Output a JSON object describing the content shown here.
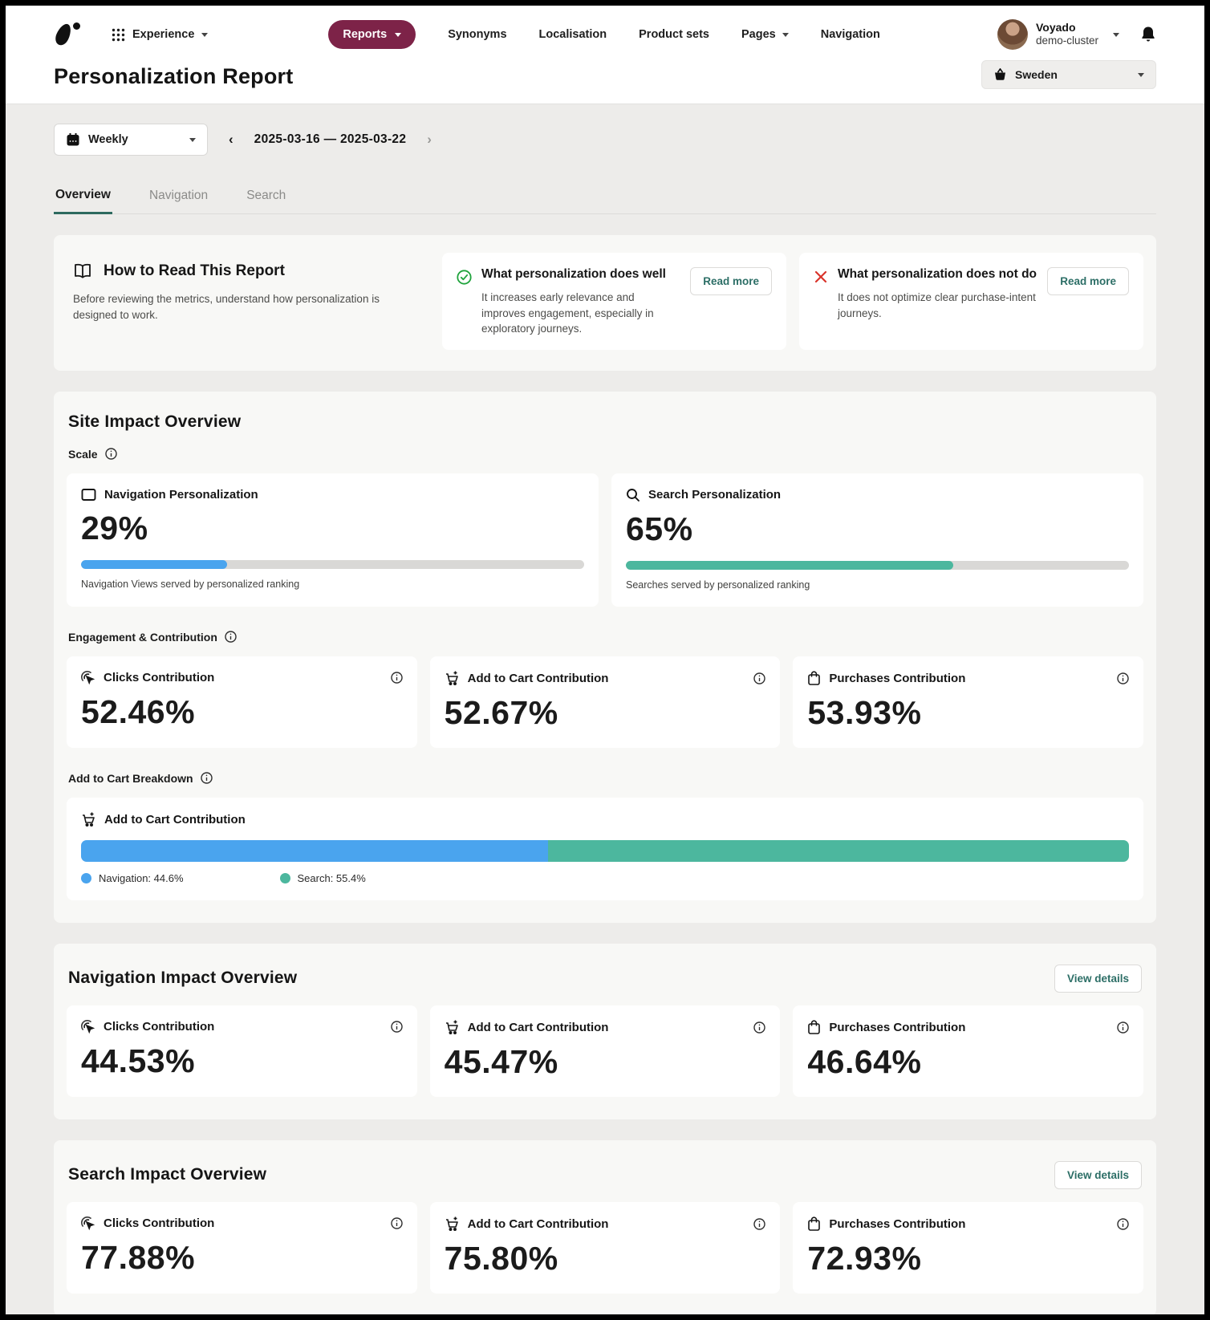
{
  "header": {
    "app_switcher_label": "Experience",
    "nav": {
      "reports": "Reports",
      "synonyms": "Synonyms",
      "localisation": "Localisation",
      "product_sets": "Product sets",
      "pages": "Pages",
      "navigation": "Navigation"
    },
    "user": {
      "name": "Voyado",
      "cluster": "demo-cluster"
    },
    "page_title": "Personalization Report",
    "market": "Sweden"
  },
  "controls": {
    "period": "Weekly",
    "date_range": "2025-03-16 — 2025-03-22",
    "prev": "‹",
    "next": "›"
  },
  "tabs": {
    "overview": "Overview",
    "navigation": "Navigation",
    "search": "Search"
  },
  "how_to": {
    "title": "How to Read This Report",
    "desc": "Before reviewing the metrics, understand how personalization is designed to work.",
    "good": {
      "title": "What personalization does well",
      "desc": "It increases early relevance and improves engagement, especially in exploratory journeys.",
      "button": "Read more"
    },
    "bad": {
      "title": "What personalization does not do",
      "desc": "It does not optimize clear purchase-intent journeys.",
      "button": "Read more"
    }
  },
  "site_impact": {
    "title": "Site Impact Overview",
    "scale_label": "Scale",
    "nav_card": {
      "title": "Navigation Personalization",
      "value": "29%",
      "pct": 29,
      "caption": "Navigation Views served by personalized ranking"
    },
    "search_card": {
      "title": "Search Personalization",
      "value": "65%",
      "pct": 65,
      "caption": "Searches served by personalized ranking"
    },
    "engagement_label": "Engagement & Contribution",
    "engagement": {
      "clicks": {
        "title": "Clicks Contribution",
        "value": "52.46%"
      },
      "add_to_cart": {
        "title": "Add to Cart  Contribution",
        "value": "52.67%"
      },
      "purchases": {
        "title": "Purchases  Contribution",
        "value": "53.93%"
      }
    },
    "breakdown_label": "Add to Cart Breakdown",
    "breakdown": {
      "title": "Add to Cart Contribution",
      "navigation_pct": 44.6,
      "search_pct": 55.4,
      "legend_navigation": "Navigation: 44.6%",
      "legend_search": "Search: 55.4%"
    }
  },
  "navigation_impact": {
    "title": "Navigation Impact Overview",
    "view_details": "View details",
    "clicks": {
      "title": "Clicks Contribution",
      "value": "44.53%"
    },
    "add_to_cart": {
      "title": "Add to Cart  Contribution",
      "value": "45.47%"
    },
    "purchases": {
      "title": "Purchases  Contribution",
      "value": "46.64%"
    }
  },
  "search_impact": {
    "title": "Search Impact Overview",
    "view_details": "View details",
    "clicks": {
      "title": "Clicks Contribution",
      "value": "77.88%"
    },
    "add_to_cart": {
      "title": "Add to Cart  Contribution",
      "value": "75.80%"
    },
    "purchases": {
      "title": "Purchases  Contribution",
      "value": "72.93%"
    }
  },
  "colors": {
    "brand_maroon": "#7d2348",
    "bar_blue": "#4aa4ee",
    "bar_teal": "#4cb79e",
    "tab_underline": "#2d6a5f",
    "link_teal": "#2c6e66",
    "success_green": "#1fa33c",
    "error_red": "#d9342b"
  }
}
